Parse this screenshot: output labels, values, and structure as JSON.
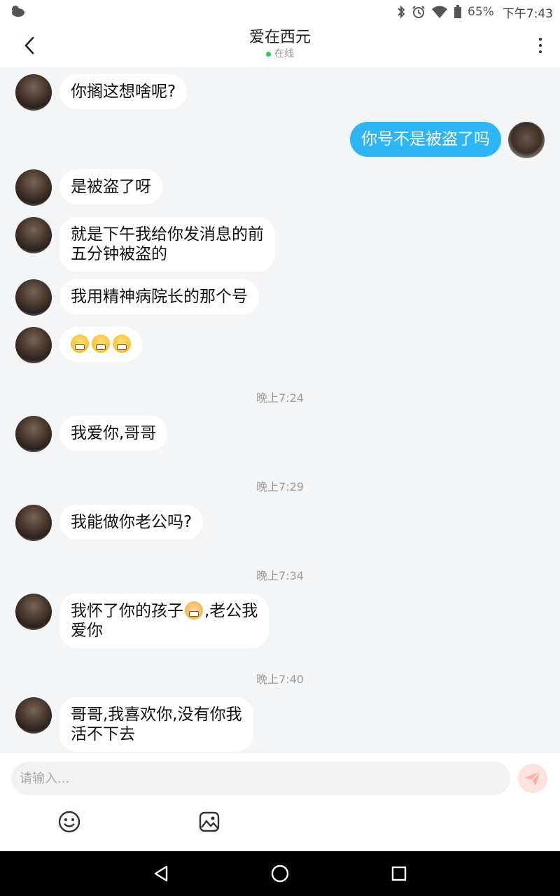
{
  "status_bar": {
    "battery": "65%",
    "time": "下午7:43",
    "icons": [
      "weather-icon",
      "bluetooth-icon",
      "alarm-icon",
      "wifi-icon",
      "battery-icon"
    ]
  },
  "header": {
    "title": "爱在西元",
    "status": "在线",
    "status_color": "#2ecc40"
  },
  "messages": [
    {
      "from": "her",
      "lines": [
        "你搁这想啥呢?"
      ]
    },
    {
      "from": "me",
      "lines": [
        "你号不是被盗了吗"
      ]
    },
    {
      "from": "her",
      "lines": [
        "是被盗了呀"
      ]
    },
    {
      "from": "her",
      "lines": [
        "就是下午我给你发消息的前",
        "五分钟被盗的"
      ]
    },
    {
      "from": "her",
      "lines": [
        "我用精神病院长的那个号"
      ]
    },
    {
      "from": "her",
      "emoji": [
        "grinning-emoji",
        "grinning-emoji",
        "grinning-emoji"
      ]
    },
    {
      "timestamp": "晚上7:24"
    },
    {
      "from": "her",
      "lines": [
        "我爱你,哥哥"
      ]
    },
    {
      "timestamp": "晚上7:29"
    },
    {
      "from": "her",
      "lines": [
        "我能做你老公吗?"
      ]
    },
    {
      "timestamp": "晚上7:34"
    },
    {
      "from": "her",
      "lines": [
        "我怀了你的孩子",
        ",老公我",
        "爱你"
      ],
      "emoji": "baby-emoji"
    },
    {
      "timestamp": "晚上7:40"
    },
    {
      "from": "her",
      "lines": [
        "哥哥,我喜欢你,没有你我",
        "活不下去"
      ]
    }
  ],
  "input": {
    "placeholder": "请输入..."
  },
  "colors": {
    "my_bubble": "#2eb5f5",
    "background": "#f4f5f7",
    "send_button": "#fde3df"
  }
}
